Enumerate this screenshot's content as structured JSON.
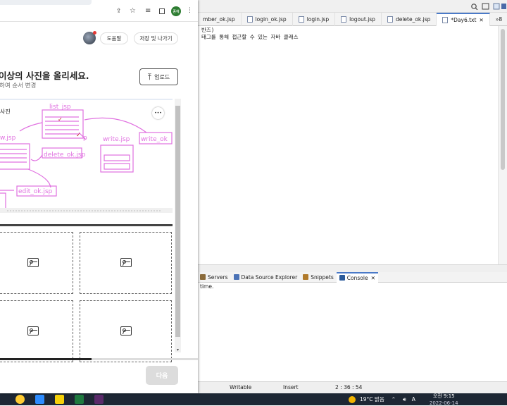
{
  "eclipse": {
    "editor_tabs": [
      "mber_ok.jsp",
      "login_ok.jsp",
      "login.jsp",
      "logout.jsp",
      "delete_ok.jsp",
      "*Day6.txt",
      "»8"
    ],
    "editor_lines": [
      "반즈)",
      "태그를 통해 접근할 수 있는 자바 클래스"
    ],
    "views_tabs": [
      "Servers",
      "Data Source Explorer",
      "Snippets",
      "Console"
    ],
    "console_text": "time.",
    "status": {
      "writable": "Writable",
      "insert": "Insert",
      "position": "2 : 36 : 54"
    }
  },
  "chrome": {
    "avatar_badge": "종혜",
    "help_label": "도움말",
    "save_exit_label": "저장 및 나가기",
    "heading": "이상의 사진을 올리세요.",
    "subheading": "하여 순서 변경",
    "upload_label": "업로드",
    "card_caption": "사진",
    "card_more": "•••",
    "next_label": "다음",
    "photo_labels": {
      "list": "list_jsp",
      "write": "write.jsp",
      "write_ok": "write_ok",
      "view": "w.jsp",
      "delete": "delete_ok.jsp",
      "edit": "edit_ok.jsp",
      "p": "p"
    }
  },
  "taskbar": {
    "weather": "19°C 맑음",
    "ime": "A",
    "ampm_time": "오전 9:15",
    "date": "2022-06-14"
  }
}
